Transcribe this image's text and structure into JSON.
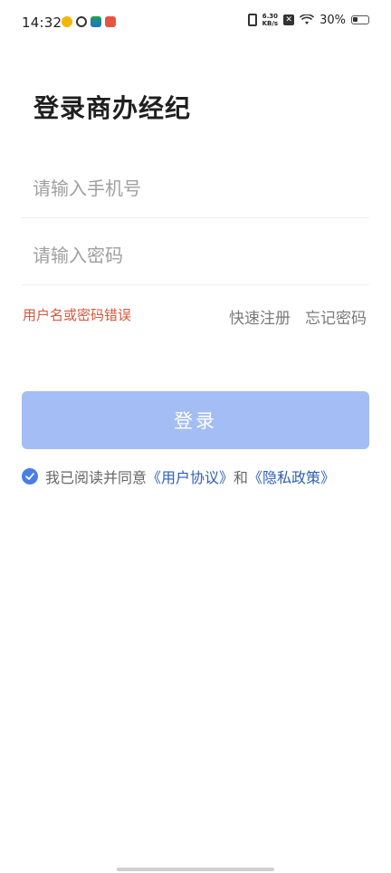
{
  "status_bar": {
    "time": "14:32",
    "net_speed_value": "6.30",
    "net_speed_unit": "KB/s",
    "battery": "30%",
    "icons": [
      "weibo-icon",
      "loop-icon",
      "app-icon",
      "red-app-icon",
      "vibrate-icon",
      "close-box-icon",
      "wifi-icon",
      "battery-icon"
    ]
  },
  "login": {
    "title": "登录商办经纪",
    "phone_placeholder": "请输入手机号",
    "password_placeholder": "请输入密码",
    "error_message": "用户名或密码错误",
    "register_link": "快速注册",
    "forgot_link": "忘记密码",
    "submit_label": "登录"
  },
  "agreement": {
    "checked": true,
    "prefix": "我已阅读并同意",
    "user_agreement": "《用户协议》",
    "and": "和",
    "privacy_policy": "《隐私政策》"
  },
  "colors": {
    "accent": "#4a7ee6",
    "button_disabled": "#a4bdf4",
    "error": "#d7563a",
    "link": "#2f5fb3"
  }
}
